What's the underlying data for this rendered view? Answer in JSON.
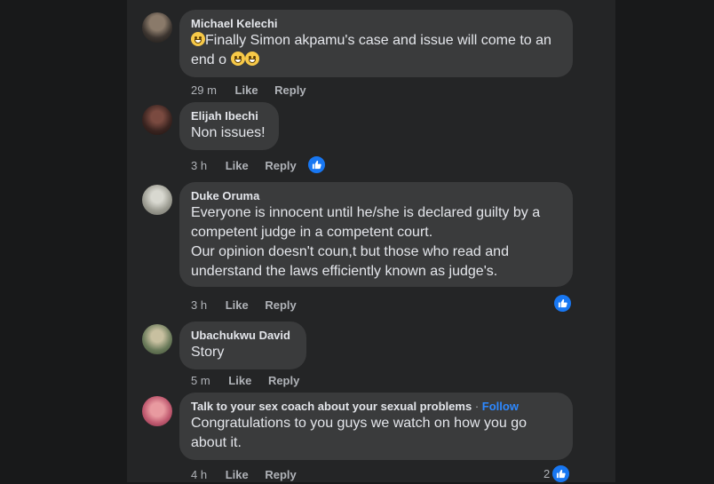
{
  "comments": [
    {
      "author": "Michael Kelechi",
      "text_lead_emoji": "flushed-face-emoji",
      "text": "Finally Simon akpamu's case and issue will come to an end o",
      "text_line1": "Finally Simon akpamu's case and issue will come to an",
      "text_line2": "end o",
      "trailing_emojis": [
        "grinning-face-emoji",
        "grinning-face-emoji"
      ],
      "time": "29 m",
      "like": "Like",
      "reply": "Reply"
    },
    {
      "author": "Elijah Ibechi",
      "text": "Non issues!",
      "time": "3 h",
      "like": "Like",
      "reply": "Reply",
      "reaction": "like"
    },
    {
      "author": "Duke Oruma",
      "lines": [
        "Everyone is innocent until he/she is declared guilty by a",
        "competent judge in a competent court.",
        "Our opinion doesn't coun,t but those who read and",
        "understand the laws efficiently known as judge's."
      ],
      "time": "3 h",
      "like": "Like",
      "reply": "Reply",
      "reaction": "like"
    },
    {
      "author": "Ubachukwu David",
      "text": "Story",
      "time": "5 m",
      "like": "Like",
      "reply": "Reply"
    },
    {
      "author": "Talk to your sex coach about your sexual problems",
      "separator": "·",
      "follow": "Follow",
      "lines": [
        "Congratulations to you guys we watch on how you go",
        "about it."
      ],
      "time": "4 h",
      "like": "Like",
      "reply": "Reply",
      "reaction": "like",
      "reaction_count": "2"
    }
  ],
  "colors": {
    "page_bg": "#18191a",
    "card_bg": "#242526",
    "bubble_bg": "#3a3b3c",
    "text": "#e4e6eb",
    "secondary": "#b0b3b8",
    "accent": "#2d88ff",
    "like_blue": "#1877f2"
  }
}
